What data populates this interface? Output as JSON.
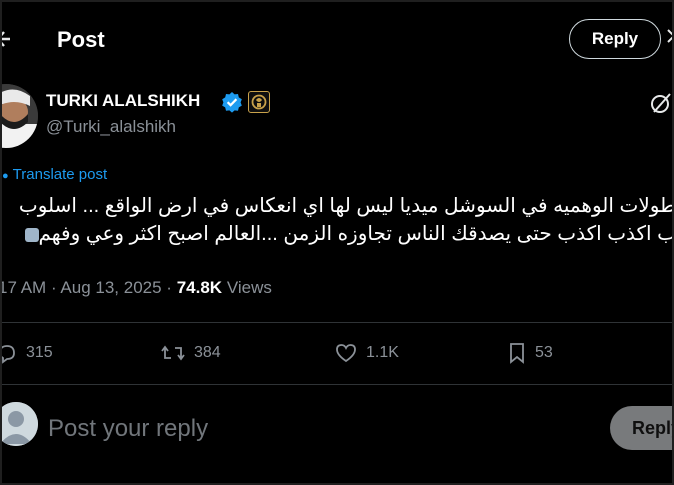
{
  "header": {
    "back_icon": "back-arrow-icon",
    "title": "Post",
    "reply_label": "Reply"
  },
  "author": {
    "name": "TURKI ALALSHIKH",
    "handle": "@Turki_alalshikh",
    "verified_color": "#1d9bf0"
  },
  "post": {
    "translate_label": "Translate post",
    "lines": [
      "طولات الوهميه في السوشل ميديا ليس لها اي انعكاس في ارض الواقع ... اسلوب",
      "ب اكذب اكذب حتى يصدقك الناس تجاوزه الزمن ...العالم اصبح اكثر وعي وفهم"
    ],
    "time": "17 AM",
    "separator": "·",
    "date": "Aug 13, 2025",
    "views_count": "74.8K",
    "views_label": "Views"
  },
  "actions": {
    "replies": "315",
    "reposts": "384",
    "likes": "1.1K",
    "bookmarks": "53"
  },
  "composer": {
    "placeholder": "Post your reply",
    "reply_label": "Reply"
  },
  "colors": {
    "background": "#000000",
    "accent": "#1d9bf0",
    "muted": "#8b9198"
  }
}
